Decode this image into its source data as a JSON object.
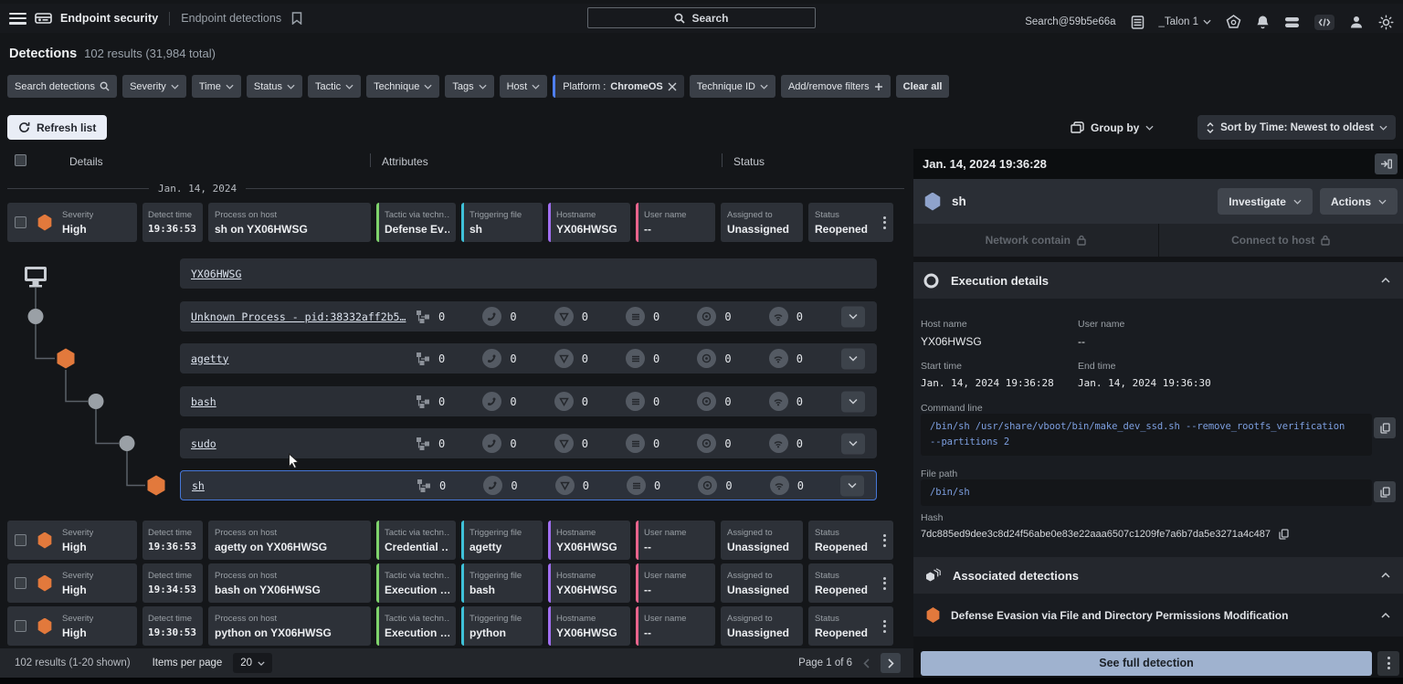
{
  "colors": {
    "accent": "#4f7ff0",
    "severity_orange": "#e2793c",
    "tactic_green": "#7fd36c",
    "file_cyan": "#3fc1d8",
    "host_purple": "#a06ef0",
    "user_pink": "#e8648c",
    "selected_blue": "#4677d8",
    "button_light": "#e9edf6",
    "see_full_blue": "#9fb2cf"
  },
  "header": {
    "app_title": "Endpoint security",
    "page_title": "Endpoint detections",
    "search_placeholder": "Search",
    "account": "Search@59b5e66a",
    "tenant": "_Talon 1"
  },
  "summary": {
    "title": "Detections",
    "results": "102 results (31,984 total)"
  },
  "filters": {
    "search_label": "Search detections",
    "dropdowns": [
      "Severity",
      "Time",
      "Status",
      "Tactic",
      "Technique",
      "Tags",
      "Host"
    ],
    "applied_label": "Platform :",
    "applied_value": "ChromeOS",
    "technique_id": "Technique ID",
    "add_remove": "Add/remove filters",
    "clear_all": "Clear all"
  },
  "toolbar": {
    "refresh": "Refresh list",
    "group_by": "Group by",
    "sort_by": "Sort by Time: Newest to oldest"
  },
  "table": {
    "columns": [
      "Details",
      "Attributes",
      "Status"
    ],
    "date_divider": "Jan. 14, 2024",
    "labels": {
      "severity": "Severity",
      "detect_time": "Detect time",
      "process": "Process on host",
      "tactic": "Tactic via techn…",
      "file": "Triggering file",
      "hostname": "Hostname",
      "user": "User name",
      "assigned": "Assigned to",
      "status": "Status"
    },
    "rows": [
      {
        "severity": "High",
        "time": "19:36:53",
        "process": "sh on YX06HWSG",
        "tactic": "Defense Ev…",
        "file": "sh",
        "hostname": "YX06HWSG",
        "user": "--",
        "assigned": "Unassigned",
        "status": "Reopened"
      },
      {
        "severity": "High",
        "time": "19:36:53",
        "process": "agetty on YX06HWSG",
        "tactic": "Credential …",
        "file": "agetty",
        "hostname": "YX06HWSG",
        "user": "--",
        "assigned": "Unassigned",
        "status": "Reopened"
      },
      {
        "severity": "High",
        "time": "19:34:53",
        "process": "bash on YX06HWSG",
        "tactic": "Execution …",
        "file": "bash",
        "hostname": "YX06HWSG",
        "user": "--",
        "assigned": "Unassigned",
        "status": "Reopened"
      },
      {
        "severity": "High",
        "time": "19:30:53",
        "process": "python on YX06HWSG",
        "tactic": "Execution …",
        "file": "python",
        "hostname": "YX06HWSG",
        "user": "--",
        "assigned": "Unassigned",
        "status": "Reopened"
      }
    ]
  },
  "tree": {
    "host": "YX06HWSG",
    "rows": [
      {
        "name": "Unknown Process - pid:38332aff2b5…",
        "counts": [
          "0",
          "0",
          "0",
          "0",
          "0",
          "0"
        ]
      },
      {
        "name": "agetty",
        "counts": [
          "0",
          "0",
          "0",
          "0",
          "0",
          "0"
        ]
      },
      {
        "name": "bash",
        "counts": [
          "0",
          "0",
          "0",
          "0",
          "0",
          "0"
        ]
      },
      {
        "name": "sudo",
        "counts": [
          "0",
          "0",
          "0",
          "0",
          "0",
          "0"
        ]
      },
      {
        "name": "sh",
        "counts": [
          "0",
          "0",
          "0",
          "0",
          "0",
          "0"
        ]
      }
    ]
  },
  "footer": {
    "results": "102 results (1-20 shown)",
    "items_per_page_label": "Items per page",
    "items_per_page": "20",
    "page": "Page 1 of 6"
  },
  "panel": {
    "timestamp": "Jan. 14, 2024 19:36:28",
    "process": "sh",
    "investigate": "Investigate",
    "actions": "Actions",
    "network_contain": "Network contain",
    "connect_to_host": "Connect to host",
    "execution": {
      "title": "Execution details",
      "host_name_label": "Host name",
      "host_name": "YX06HWSG",
      "user_name_label": "User name",
      "user_name": "--",
      "start_label": "Start time",
      "start": "Jan. 14, 2024 19:36:28",
      "end_label": "End time",
      "end": "Jan. 14, 2024 19:36:30",
      "cmd_label": "Command line",
      "cmd": "/bin/sh /usr/share/vboot/bin/make_dev_ssd.sh --remove_rootfs_verification\n--partitions 2",
      "path_label": "File path",
      "path": "/bin/sh",
      "hash_label": "Hash",
      "hash": "7dc885ed9dee3c8d24f56abe0e83e22aaa6507c1209fe7a6b7da5e3271a4c487"
    },
    "associated": {
      "title": "Associated detections",
      "item": "Defense Evasion via File and Directory Permissions Modification"
    },
    "see_full": "See full detection"
  }
}
